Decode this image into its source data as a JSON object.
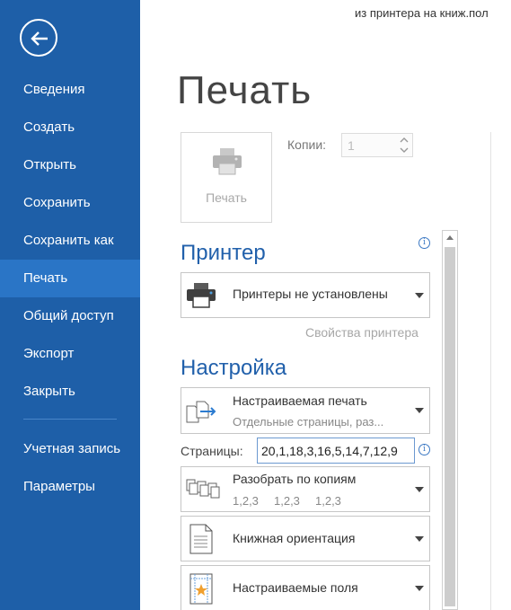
{
  "top_clipped_text": "из принтера на книж.пол",
  "sidebar": {
    "items": [
      {
        "label": "Сведения"
      },
      {
        "label": "Создать"
      },
      {
        "label": "Открыть"
      },
      {
        "label": "Сохранить"
      },
      {
        "label": "Сохранить как"
      },
      {
        "label": "Печать",
        "active": true
      },
      {
        "label": "Общий доступ"
      },
      {
        "label": "Экспорт"
      },
      {
        "label": "Закрыть"
      },
      {
        "label": "Учетная запись"
      },
      {
        "label": "Параметры"
      }
    ]
  },
  "page_title": "Печать",
  "print_button": {
    "label": "Печать"
  },
  "copies": {
    "label": "Копии:",
    "value": "1"
  },
  "printer_section": {
    "title": "Принтер",
    "selected": "Принтеры не установлены",
    "properties_link": "Свойства принтера"
  },
  "settings_section": {
    "title": "Настройка",
    "print_range": {
      "title": "Настраиваемая печать",
      "subtitle": "Отдельные страницы, раз..."
    },
    "pages": {
      "label": "Страницы:",
      "value": "20,1,18,3,16,5,14,7,12,9"
    },
    "collate": {
      "title": "Разобрать по копиям",
      "subtitle_parts": [
        "1,2,3",
        "1,2,3",
        "1,2,3"
      ]
    },
    "orientation": {
      "title": "Книжная ориентация"
    },
    "margins": {
      "title": "Настраиваемые поля"
    }
  },
  "colors": {
    "sidebar": "#1e5fa8",
    "sidebar_active": "#2a75c6",
    "accent": "#2160ab"
  },
  "icons": [
    "back-arrow-icon",
    "printer-icon",
    "info-icon",
    "chevron-down-icon",
    "copy-pages-icon",
    "collate-icon",
    "portrait-page-icon",
    "margins-icon"
  ]
}
